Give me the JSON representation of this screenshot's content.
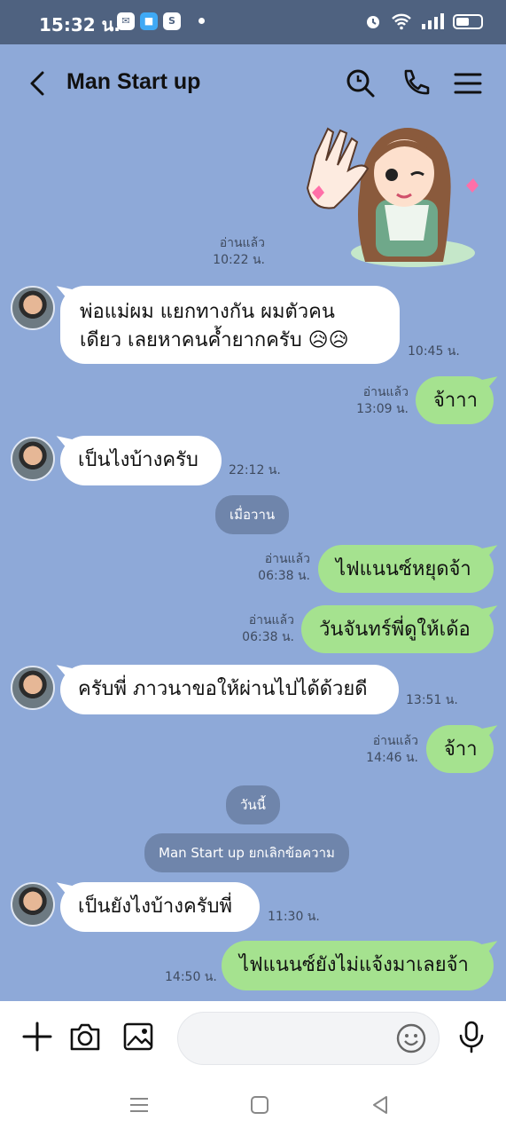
{
  "status": {
    "time": "15:32 น.",
    "left_icons": [
      "messenger-icon",
      "app-icon",
      "shopee-icon"
    ],
    "right_icons": [
      "alarm-icon",
      "wifi-icon",
      "signal-icon",
      "battery-icon"
    ]
  },
  "header": {
    "title": "Man Start up",
    "actions": [
      "search-icon",
      "phone-icon",
      "menu-icon"
    ]
  },
  "messages": [
    {
      "side": "out",
      "type": "sticker",
      "read": "อ่านแล้ว",
      "time": "10:22 น."
    },
    {
      "side": "in",
      "line1": "พ่อแม่ผม แยกทางกัน ผมตัวคน",
      "line2": "เดียว เลยหาคนค้ำยากครับ 😥😥",
      "time": "10:45 น."
    },
    {
      "side": "out",
      "text": "จ้าาา",
      "read": "อ่านแล้ว",
      "time": "13:09 น."
    },
    {
      "side": "in",
      "text": "เป็นไงบ้างครับ",
      "time": "22:12 น."
    },
    {
      "type": "date",
      "text": "เมื่อวาน"
    },
    {
      "side": "out",
      "text": "ไฟแนนซ์หยุดจ้า",
      "read": "อ่านแล้ว",
      "time": "06:38 น."
    },
    {
      "side": "out",
      "text": "วันจันทร์พี่ดูให้เด้อ",
      "read": "อ่านแล้ว",
      "time": "06:38 น."
    },
    {
      "side": "in",
      "text": "ครับพี่ ภาวนาขอให้ผ่านไปได้ด้วยดี",
      "time": "13:51 น."
    },
    {
      "side": "out",
      "text": "จ้าา",
      "read": "อ่านแล้ว",
      "time": "14:46 น."
    },
    {
      "type": "date",
      "text": "วันนี้"
    },
    {
      "type": "system",
      "text": "Man Start up ยกเลิกข้อความ"
    },
    {
      "side": "in",
      "text": "เป็นยังไงบ้างครับพี่",
      "time": "11:30 น."
    },
    {
      "side": "out",
      "text": "ไฟแนนซ์ยังไม่แจ้งมาเลยจ้า",
      "time": "14:50 น."
    }
  ],
  "input": {
    "placeholder": "",
    "left_icons": [
      "plus-icon",
      "camera-icon",
      "image-icon"
    ],
    "right_icons": [
      "emoji-icon",
      "microphone-icon"
    ]
  },
  "colors": {
    "chat_background": "#8ea9d8",
    "status_bar": "#4f6280",
    "incoming_bubble": "#ffffff",
    "outgoing_bubble": "#a5e28f",
    "date_pill": "#6f85ab"
  }
}
